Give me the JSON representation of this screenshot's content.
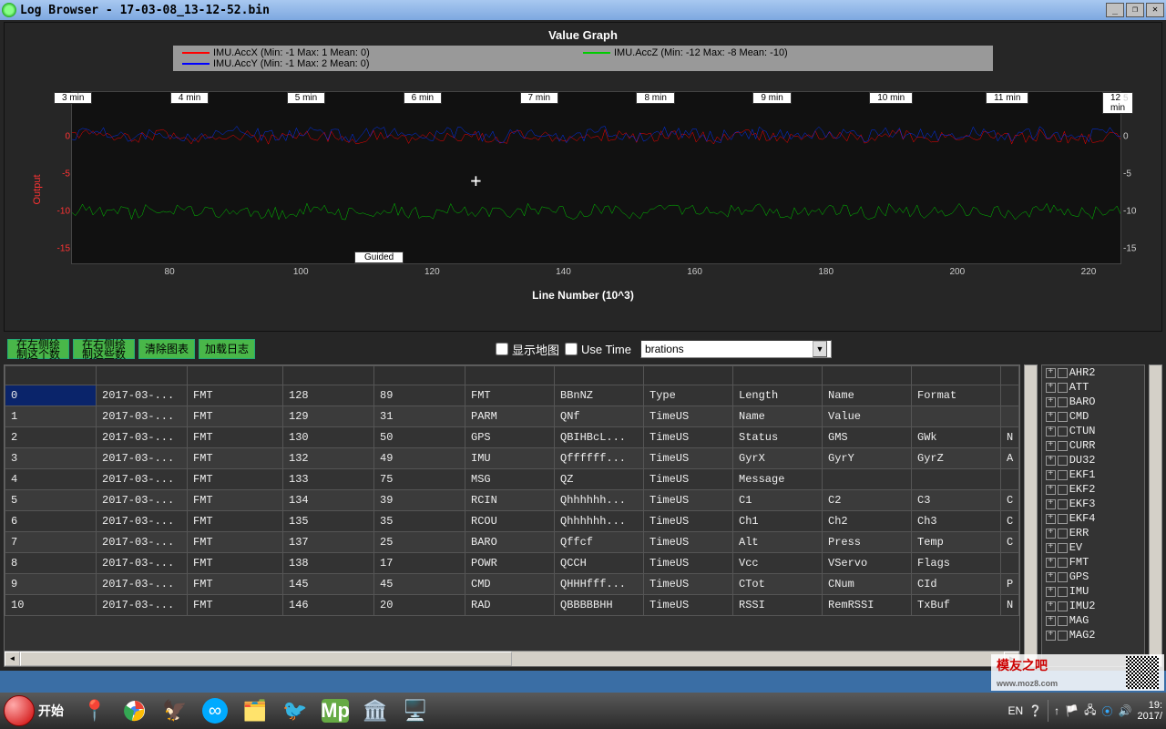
{
  "window": {
    "title": "Log Browser - 17-03-08_13-12-52.bin"
  },
  "chart_data": {
    "type": "line",
    "title": "Value Graph",
    "xlabel": "Line Number (10^3)",
    "ylabel": "Output",
    "xlim": [
      65,
      225
    ],
    "ylim": [
      -17,
      6
    ],
    "x_ticks": [
      80,
      100,
      120,
      140,
      160,
      180,
      200,
      220
    ],
    "y_ticks_left": [
      5,
      0,
      -5,
      -10,
      -15
    ],
    "y_ticks_right": [
      5,
      0,
      -5,
      -10,
      -15
    ],
    "time_markers": [
      "3 min",
      "4 min",
      "5 min",
      "6 min",
      "7 min",
      "8 min",
      "9 min",
      "10 min",
      "11 min",
      "12 min"
    ],
    "mode_label": "Guided",
    "series": [
      {
        "name": "IMU.AccX",
        "stats": "(Min: -1 Max: 1 Mean: 0)",
        "color": "#ff0000",
        "mean": 0,
        "noise": 0.8
      },
      {
        "name": "IMU.AccY",
        "stats": "(Min: -1 Max: 2 Mean: 0)",
        "color": "#0033ff",
        "mean": 0.3,
        "noise": 0.9
      },
      {
        "name": "IMU.AccZ",
        "stats": "(Min: -12 Max: -8 Mean: -10)",
        "color": "#00cc00",
        "mean": -10,
        "noise": 0.9
      }
    ]
  },
  "toolbar": {
    "btn_left_plot": "在左侧绘\n制这个数",
    "btn_right_plot": "在右侧绘\n制这些数",
    "btn_clear": "清除图表",
    "btn_load": "加载日志",
    "chk_map": "显示地图",
    "chk_time": "Use Time",
    "combo_value": "brations"
  },
  "table": {
    "headers": [
      "",
      "",
      "",
      "",
      "",
      "",
      "",
      "",
      "",
      "",
      "",
      ""
    ],
    "rows": [
      [
        "0",
        "2017-03-...",
        "FMT",
        "128",
        "89",
        "FMT",
        "BBnNZ",
        "Type",
        "Length",
        "Name",
        "Format",
        ""
      ],
      [
        "1",
        "2017-03-...",
        "FMT",
        "129",
        "31",
        "PARM",
        "QNf",
        "TimeUS",
        "Name",
        "Value",
        "",
        ""
      ],
      [
        "2",
        "2017-03-...",
        "FMT",
        "130",
        "50",
        "GPS",
        "QBIHBcL...",
        "TimeUS",
        "Status",
        "GMS",
        "GWk",
        "N"
      ],
      [
        "3",
        "2017-03-...",
        "FMT",
        "132",
        "49",
        "IMU",
        "Qffffff...",
        "TimeUS",
        "GyrX",
        "GyrY",
        "GyrZ",
        "A"
      ],
      [
        "4",
        "2017-03-...",
        "FMT",
        "133",
        "75",
        "MSG",
        "QZ",
        "TimeUS",
        "Message",
        "",
        "",
        ""
      ],
      [
        "5",
        "2017-03-...",
        "FMT",
        "134",
        "39",
        "RCIN",
        "Qhhhhhh...",
        "TimeUS",
        "C1",
        "C2",
        "C3",
        "C"
      ],
      [
        "6",
        "2017-03-...",
        "FMT",
        "135",
        "35",
        "RCOU",
        "Qhhhhhh...",
        "TimeUS",
        "Ch1",
        "Ch2",
        "Ch3",
        "C"
      ],
      [
        "7",
        "2017-03-...",
        "FMT",
        "137",
        "25",
        "BARO",
        "Qffcf",
        "TimeUS",
        "Alt",
        "Press",
        "Temp",
        "C"
      ],
      [
        "8",
        "2017-03-...",
        "FMT",
        "138",
        "17",
        "POWR",
        "QCCH",
        "TimeUS",
        "Vcc",
        "VServo",
        "Flags",
        ""
      ],
      [
        "9",
        "2017-03-...",
        "FMT",
        "145",
        "45",
        "CMD",
        "QHHHfff...",
        "TimeUS",
        "CTot",
        "CNum",
        "CId",
        "P"
      ],
      [
        "10",
        "2017-03-...",
        "FMT",
        "146",
        "20",
        "RAD",
        "QBBBBBHH",
        "TimeUS",
        "RSSI",
        "RemRSSI",
        "TxBuf",
        "N"
      ]
    ]
  },
  "tree": {
    "items": [
      "AHR2",
      "ATT",
      "BARO",
      "CMD",
      "CTUN",
      "CURR",
      "DU32",
      "EKF1",
      "EKF2",
      "EKF3",
      "EKF4",
      "ERR",
      "EV",
      "FMT",
      "GPS",
      "IMU",
      "IMU2",
      "MAG",
      "MAG2"
    ]
  },
  "taskbar": {
    "start": "开始",
    "lang": "EN",
    "clock1": "19:",
    "clock2": "2017/"
  },
  "watermark": {
    "text": "模友之吧",
    "url": "www.moz8.com"
  }
}
